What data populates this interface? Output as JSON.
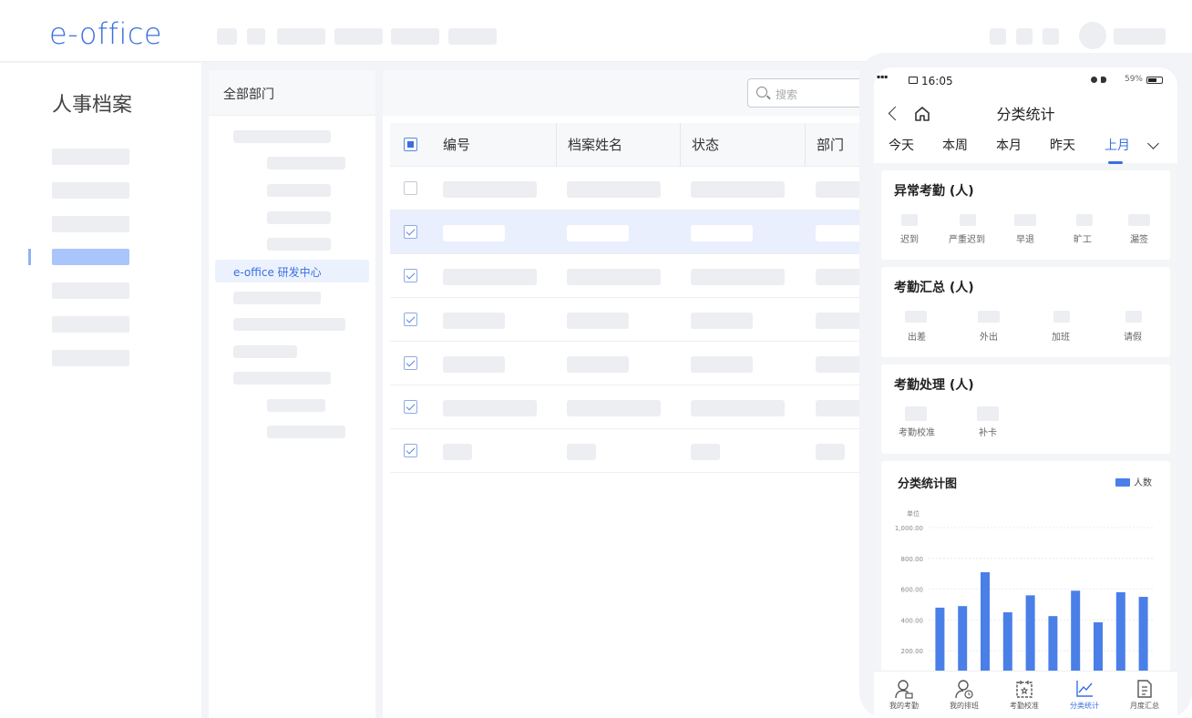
{
  "app": {
    "logo": "e-office",
    "module_title": "人事档案"
  },
  "tree": {
    "header": "全部部门",
    "selected": "e-office 研发中心"
  },
  "table": {
    "search_placeholder": "搜索",
    "columns": [
      "编号",
      "档案姓名",
      "状态",
      "部门"
    ],
    "rows": [
      {
        "checked": false,
        "highlight": false
      },
      {
        "checked": true,
        "highlight": true
      },
      {
        "checked": true,
        "highlight": false
      },
      {
        "checked": true,
        "highlight": false
      },
      {
        "checked": true,
        "highlight": false
      },
      {
        "checked": true,
        "highlight": false
      },
      {
        "checked": true,
        "highlight": false
      }
    ]
  },
  "phone": {
    "status_time": "16:05",
    "status_battery": "59%",
    "title": "分类统计",
    "tabs": [
      "今天",
      "本周",
      "本月",
      "昨天",
      "上月"
    ],
    "active_tab": "上月",
    "cards": [
      {
        "title": "异常考勤 (人)",
        "items": [
          "迟到",
          "严重迟到",
          "早退",
          "旷工",
          "漏签"
        ]
      },
      {
        "title": "考勤汇总 (人)",
        "items": [
          "出差",
          "外出",
          "加班",
          "请假"
        ]
      },
      {
        "title": "考勤处理 (人)",
        "items": [
          "考勤校准",
          "补卡"
        ]
      }
    ],
    "tabbar": [
      {
        "label": "我的考勤",
        "icon": "user-icon"
      },
      {
        "label": "我的排班",
        "icon": "user-clock-icon"
      },
      {
        "label": "考勤校准",
        "icon": "calendar-icon"
      },
      {
        "label": "分类统计",
        "icon": "line-chart-icon"
      },
      {
        "label": "月度汇总",
        "icon": "document-icon"
      }
    ],
    "active_tabbar": "分类统计"
  },
  "chart_data": {
    "type": "bar",
    "title": "分类统计图",
    "ylabel": "单位",
    "legend": "人数",
    "legend_placement": "top-right",
    "y_ticks": [
      "200.00",
      "400.00",
      "600.00",
      "800.00",
      "1,000.00"
    ],
    "ylim": [
      0,
      1000
    ],
    "grid": true,
    "color": "#4a7fe8",
    "series": [
      {
        "name": "人数",
        "values": [
          480,
          490,
          710,
          450,
          560,
          425,
          590,
          385,
          580,
          550
        ]
      }
    ]
  }
}
